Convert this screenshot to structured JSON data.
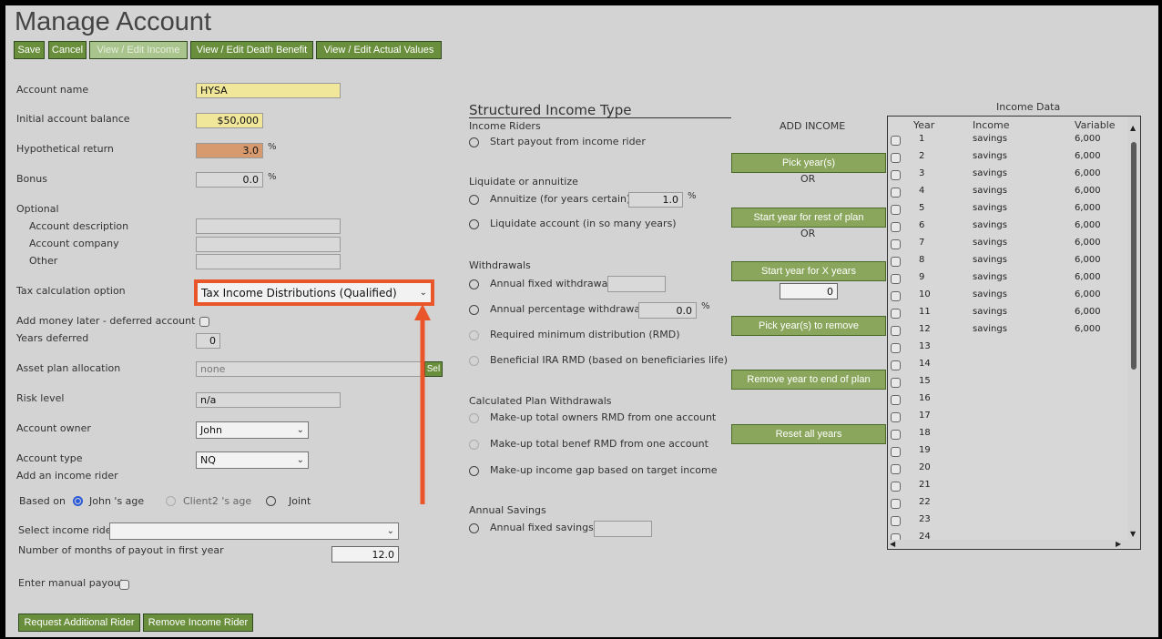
{
  "page_title": "Manage Account",
  "toolbar": {
    "save": "Save",
    "cancel": "Cancel",
    "view_edit_income": "View / Edit Income",
    "view_edit_death_benefit": "View / Edit Death Benefit",
    "view_edit_actual_values": "View / Edit Actual Values"
  },
  "form": {
    "account_name_label": "Account name",
    "account_name_value": "HYSA",
    "initial_balance_label": "Initial account balance",
    "initial_balance_value": "$50,000",
    "hypothetical_return_label": "Hypothetical return",
    "hypothetical_return_value": "3.0",
    "bonus_label": "Bonus",
    "bonus_value": "0.0",
    "percent": "%",
    "optional_label": "Optional",
    "account_description_label": "Account description",
    "account_company_label": "Account company",
    "other_label": "Other",
    "tax_calc_label": "Tax calculation option",
    "tax_calc_value": "Tax Income Distributions (Qualified)",
    "add_money_label": "Add money later - deferred account",
    "years_deferred_label": "Years deferred",
    "years_deferred_value": "0",
    "asset_plan_label": "Asset plan allocation",
    "asset_plan_value": "none",
    "asset_plan_button": "Sel",
    "risk_level_label": "Risk level",
    "risk_level_value": "n/a",
    "account_owner_label": "Account owner",
    "account_owner_value": "John",
    "account_type_label": "Account type",
    "account_type_value": "NQ",
    "add_income_rider_label": "Add an income rider",
    "based_on_label": "Based on",
    "based_on_options": [
      "John 's age",
      "Client2 's age",
      "Joint"
    ],
    "select_income_rider_label": "Select income rider",
    "select_income_rider_value": "",
    "months_payout_label": "Number of months of payout in first year",
    "months_payout_value": "12.0",
    "manual_payout_label": "Enter manual payout",
    "request_rider_button": "Request Additional Rider",
    "remove_rider_button": "Remove Income Rider"
  },
  "structured": {
    "title": "Structured Income Type",
    "income_riders_heading": "Income Riders",
    "start_payout": "Start payout from income rider",
    "liquidate_heading": "Liquidate or annuitize",
    "annuitize": "Annuitize (for years certain)",
    "annuitize_value": "1.0",
    "liquidate": "Liquidate account (in so many years)",
    "withdrawals_heading": "Withdrawals",
    "annual_fixed_withdrawal": "Annual fixed withdrawal",
    "annual_fixed_withdrawal_value": "",
    "annual_pct_withdrawal": "Annual percentage withdrawal",
    "annual_pct_withdrawal_value": "0.0",
    "rmd": "Required minimum distribution (RMD)",
    "beneficial_rmd": "Beneficial IRA RMD (based on beneficiaries life)",
    "calc_heading": "Calculated Plan Withdrawals",
    "makeup_owners": "Make-up total owners RMD from one account",
    "makeup_benef": "Make-up total benef RMD from one account",
    "makeup_gap": "Make-up income gap based on target income",
    "savings_heading": "Annual Savings",
    "annual_fixed_savings": "Annual fixed savings",
    "annual_fixed_savings_value": ""
  },
  "add_income": {
    "title": "ADD INCOME",
    "pick_years": "Pick year(s)",
    "or1": "OR",
    "start_rest": "Start year for rest of plan",
    "or2": "OR",
    "start_x": "Start year for X years",
    "x_years_value": "0",
    "pick_remove": "Pick year(s) to remove",
    "remove_end": "Remove year to end of plan",
    "reset_all": "Reset all years"
  },
  "income_table": {
    "title": "Income Data",
    "headers": [
      "Year",
      "Income",
      "Variable"
    ],
    "rows": [
      {
        "year": "1",
        "income": "savings",
        "variable": "6,000"
      },
      {
        "year": "2",
        "income": "savings",
        "variable": "6,000"
      },
      {
        "year": "3",
        "income": "savings",
        "variable": "6,000"
      },
      {
        "year": "4",
        "income": "savings",
        "variable": "6,000"
      },
      {
        "year": "5",
        "income": "savings",
        "variable": "6,000"
      },
      {
        "year": "6",
        "income": "savings",
        "variable": "6,000"
      },
      {
        "year": "7",
        "income": "savings",
        "variable": "6,000"
      },
      {
        "year": "8",
        "income": "savings",
        "variable": "6,000"
      },
      {
        "year": "9",
        "income": "savings",
        "variable": "6,000"
      },
      {
        "year": "10",
        "income": "savings",
        "variable": "6,000"
      },
      {
        "year": "11",
        "income": "savings",
        "variable": "6,000"
      },
      {
        "year": "12",
        "income": "savings",
        "variable": "6,000"
      },
      {
        "year": "13",
        "income": "",
        "variable": ""
      },
      {
        "year": "14",
        "income": "",
        "variable": ""
      },
      {
        "year": "15",
        "income": "",
        "variable": ""
      },
      {
        "year": "16",
        "income": "",
        "variable": ""
      },
      {
        "year": "17",
        "income": "",
        "variable": ""
      },
      {
        "year": "18",
        "income": "",
        "variable": ""
      },
      {
        "year": "19",
        "income": "",
        "variable": ""
      },
      {
        "year": "20",
        "income": "",
        "variable": ""
      },
      {
        "year": "21",
        "income": "",
        "variable": ""
      },
      {
        "year": "22",
        "income": "",
        "variable": ""
      },
      {
        "year": "23",
        "income": "",
        "variable": ""
      },
      {
        "year": "24",
        "income": "",
        "variable": ""
      }
    ]
  },
  "colors": {
    "button": "#6a8f3c",
    "highlight": "#e8562a",
    "yellow_field": "#f1e79b",
    "orange_field": "#d69a6e"
  }
}
